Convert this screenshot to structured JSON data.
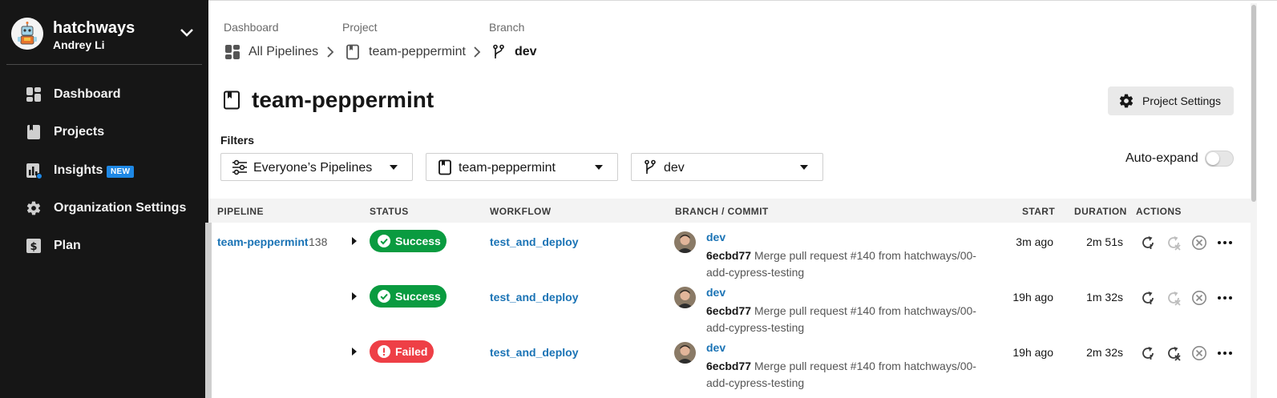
{
  "org": {
    "name": "hatchways",
    "user": "Andrey Li"
  },
  "sidebar": {
    "items": [
      {
        "label": "Dashboard",
        "icon": "dashboard-icon"
      },
      {
        "label": "Projects",
        "icon": "project-icon"
      },
      {
        "label": "Insights",
        "icon": "insights-icon",
        "badge": "NEW"
      },
      {
        "label": "Organization Settings",
        "icon": "gear-icon"
      },
      {
        "label": "Plan",
        "icon": "dollar-icon"
      }
    ]
  },
  "breadcrumb": {
    "dashboard_caption": "Dashboard",
    "dashboard_label": "All Pipelines",
    "project_caption": "Project",
    "project_label": "team-peppermint",
    "branch_caption": "Branch",
    "branch_label": "dev"
  },
  "page": {
    "title": "team-peppermint",
    "settings_button": "Project Settings"
  },
  "filters": {
    "label": "Filters",
    "pipelines": "Everyone’s Pipelines",
    "project": "team-peppermint",
    "branch": "dev",
    "auto_expand_label": "Auto-expand",
    "auto_expand_on": false
  },
  "table": {
    "columns": [
      "PIPELINE",
      "STATUS",
      "WORKFLOW",
      "BRANCH / COMMIT",
      "START",
      "DURATION",
      "ACTIONS"
    ],
    "pipeline_name": "team-peppermint",
    "pipeline_number": "138",
    "rows": [
      {
        "status": "Success",
        "status_color": "#0a9b40",
        "workflow": "test_and_deploy",
        "branch": "dev",
        "commit_hash": "6ecbd77",
        "commit_msg": "Merge pull request #140 from hatchways/00-add-cypress-testing",
        "start": "3m ago",
        "duration": "2m 51s",
        "rerun_failed_enabled": false
      },
      {
        "status": "Success",
        "status_color": "#0a9b40",
        "workflow": "test_and_deploy",
        "branch": "dev",
        "commit_hash": "6ecbd77",
        "commit_msg": "Merge pull request #140 from hatchways/00-add-cypress-testing",
        "start": "19h ago",
        "duration": "1m 32s",
        "rerun_failed_enabled": false
      },
      {
        "status": "Failed",
        "status_color": "#ee3f46",
        "workflow": "test_and_deploy",
        "branch": "dev",
        "commit_hash": "6ecbd77",
        "commit_msg": "Merge pull request #140 from hatchways/00-add-cypress-testing",
        "start": "19h ago",
        "duration": "2m 32s",
        "rerun_failed_enabled": true
      }
    ]
  }
}
